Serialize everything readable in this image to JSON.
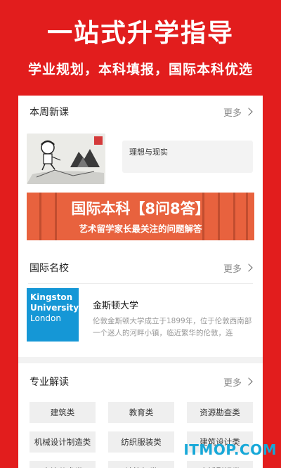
{
  "hero": {
    "title": "一站式升学指导",
    "subtitle": "学业规划，本科填报，国际本科优选"
  },
  "new_courses": {
    "title": "本周新课",
    "more": "更多",
    "course_title": "理想与现实"
  },
  "banner": {
    "title": "国际本科【8问8答】",
    "subtitle": "艺术留学家长最关注的问题解答"
  },
  "universities": {
    "title": "国际名校",
    "more": "更多",
    "logo_lines": [
      "Kingston",
      "University",
      "London"
    ],
    "name": "金斯顿大学",
    "description": "伦敦金斯顿大学成立于1899年，位于伦敦西南部一个迷人的河畔小镇，临近繁华的伦敦，连"
  },
  "majors": {
    "title": "专业解读",
    "more": "更多",
    "items": [
      "建筑类",
      "教育类",
      "资源勘查类",
      "机械设计制造类",
      "纺织服装类",
      "建筑设计类",
      "表演艺术类",
      "计算机类",
      "广播影视类"
    ]
  },
  "watermark": "ITMOP.COM",
  "colors": {
    "brand_red": "#e21d1d",
    "banner_orange": "#e8623e",
    "logo_blue": "#1597d6"
  }
}
